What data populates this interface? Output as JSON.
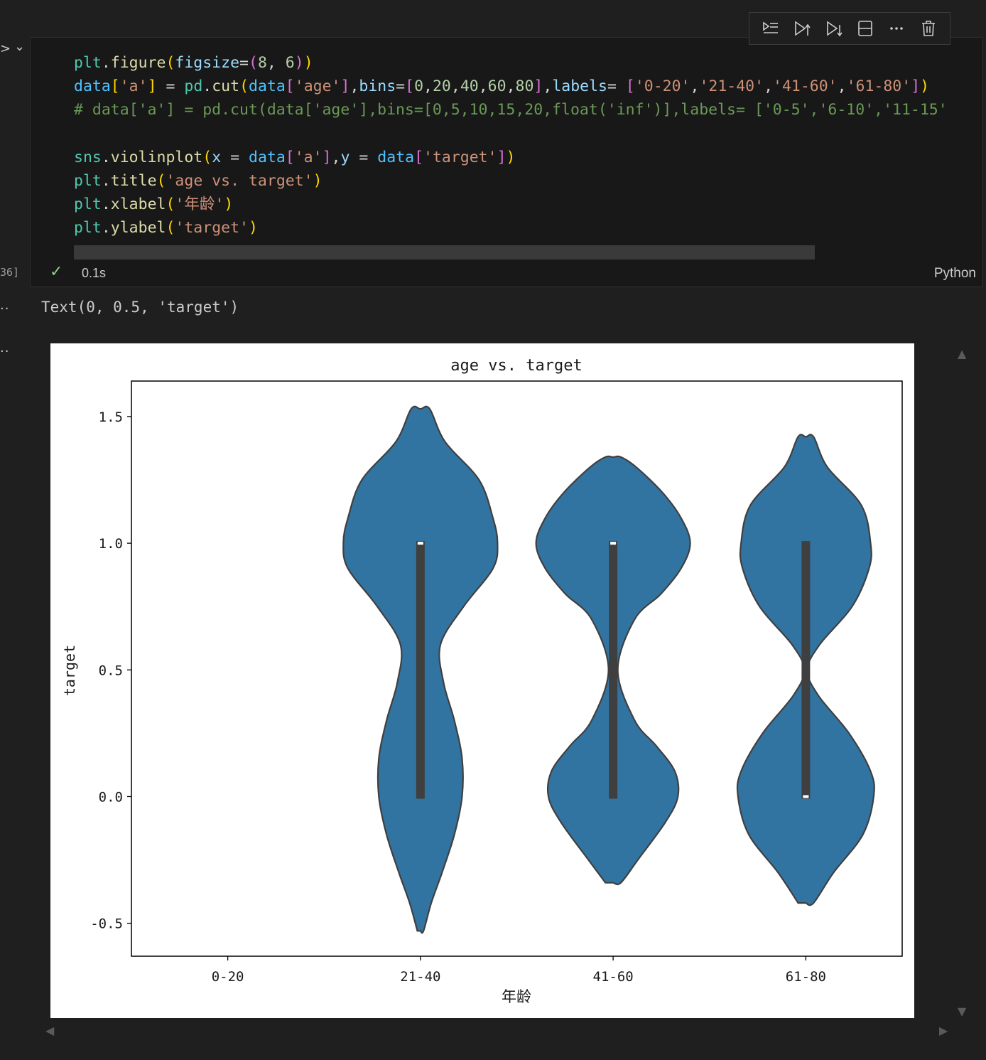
{
  "gutter": {
    "expand_glyph": ">",
    "collapse_glyph": "⌄",
    "execution_count": "36]",
    "output_dots": "··"
  },
  "toolbar": {
    "buttons": [
      {
        "icon": "run-by-line-icon"
      },
      {
        "icon": "run-above-icon"
      },
      {
        "icon": "run-below-icon"
      },
      {
        "icon": "split-cell-icon"
      },
      {
        "icon": "more-actions-icon",
        "glyph": "···"
      },
      {
        "icon": "delete-cell-icon"
      }
    ]
  },
  "code": {
    "lines": [
      "plt.figure(figsize=(8, 6))",
      "data['a'] = pd.cut(data['age'],bins=[0,20,40,60,80],labels= ['0-20','21-40','41-60','61-80'])",
      "# data['a'] = pd.cut(data['age'],bins=[0,5,10,15,20,float('inf')],labels= ['0-5','6-10','11-15'",
      "",
      "sns.violinplot(x = data['a'],y = data['target'])",
      "plt.title('age vs. target')",
      "plt.xlabel('年龄')",
      "plt.ylabel('target')"
    ]
  },
  "status": {
    "check_glyph": "✓",
    "duration": "0.1s",
    "language": "Python"
  },
  "output": {
    "text": "Text(0, 0.5, 'target')"
  },
  "chart_data": {
    "type": "violin",
    "title": "age vs. target",
    "xlabel": "年龄",
    "ylabel": "target",
    "categories": [
      "0-20",
      "21-40",
      "41-60",
      "61-80"
    ],
    "ylim": [
      -0.63,
      1.64
    ],
    "yticks": [
      -0.5,
      0.0,
      0.5,
      1.0,
      1.5
    ],
    "ytick_labels": [
      "-0.5",
      "0.0",
      "0.5",
      "1.0",
      "1.5"
    ],
    "fill_color": "#3274a1",
    "edge_color": "#3f3f3f",
    "violins": [
      {
        "category": "21-40",
        "min": -0.53,
        "max": 1.53,
        "q1": 0.0,
        "q3": 1.0,
        "median": 1.0,
        "profile": [
          [
            -0.53,
            0.02
          ],
          [
            -0.42,
            0.07
          ],
          [
            -0.3,
            0.14
          ],
          [
            -0.15,
            0.22
          ],
          [
            0.0,
            0.27
          ],
          [
            0.15,
            0.27
          ],
          [
            0.3,
            0.22
          ],
          [
            0.45,
            0.15
          ],
          [
            0.6,
            0.13
          ],
          [
            0.75,
            0.28
          ],
          [
            0.9,
            0.47
          ],
          [
            1.0,
            0.5
          ],
          [
            1.1,
            0.47
          ],
          [
            1.25,
            0.38
          ],
          [
            1.4,
            0.16
          ],
          [
            1.53,
            0.06
          ]
        ]
      },
      {
        "category": "41-60",
        "min": -0.34,
        "max": 1.34,
        "q1": 0.0,
        "q3": 1.0,
        "median": 1.0,
        "profile": [
          [
            -0.34,
            0.05
          ],
          [
            -0.25,
            0.16
          ],
          [
            -0.1,
            0.34
          ],
          [
            0.0,
            0.42
          ],
          [
            0.1,
            0.4
          ],
          [
            0.2,
            0.28
          ],
          [
            0.3,
            0.14
          ],
          [
            0.5,
            0.03
          ],
          [
            0.7,
            0.14
          ],
          [
            0.8,
            0.31
          ],
          [
            0.9,
            0.44
          ],
          [
            1.0,
            0.5
          ],
          [
            1.1,
            0.44
          ],
          [
            1.2,
            0.32
          ],
          [
            1.3,
            0.15
          ],
          [
            1.34,
            0.05
          ]
        ]
      },
      {
        "category": "61-80",
        "min": -0.42,
        "max": 1.42,
        "q1": 0.0,
        "q3": 1.0,
        "median": 0.0,
        "profile": [
          [
            -0.42,
            0.05
          ],
          [
            -0.3,
            0.18
          ],
          [
            -0.15,
            0.37
          ],
          [
            0.0,
            0.44
          ],
          [
            0.1,
            0.42
          ],
          [
            0.25,
            0.28
          ],
          [
            0.4,
            0.08
          ],
          [
            0.5,
            0.01
          ],
          [
            0.6,
            0.09
          ],
          [
            0.75,
            0.3
          ],
          [
            0.9,
            0.41
          ],
          [
            1.0,
            0.42
          ],
          [
            1.15,
            0.36
          ],
          [
            1.3,
            0.14
          ],
          [
            1.42,
            0.05
          ]
        ]
      }
    ]
  }
}
